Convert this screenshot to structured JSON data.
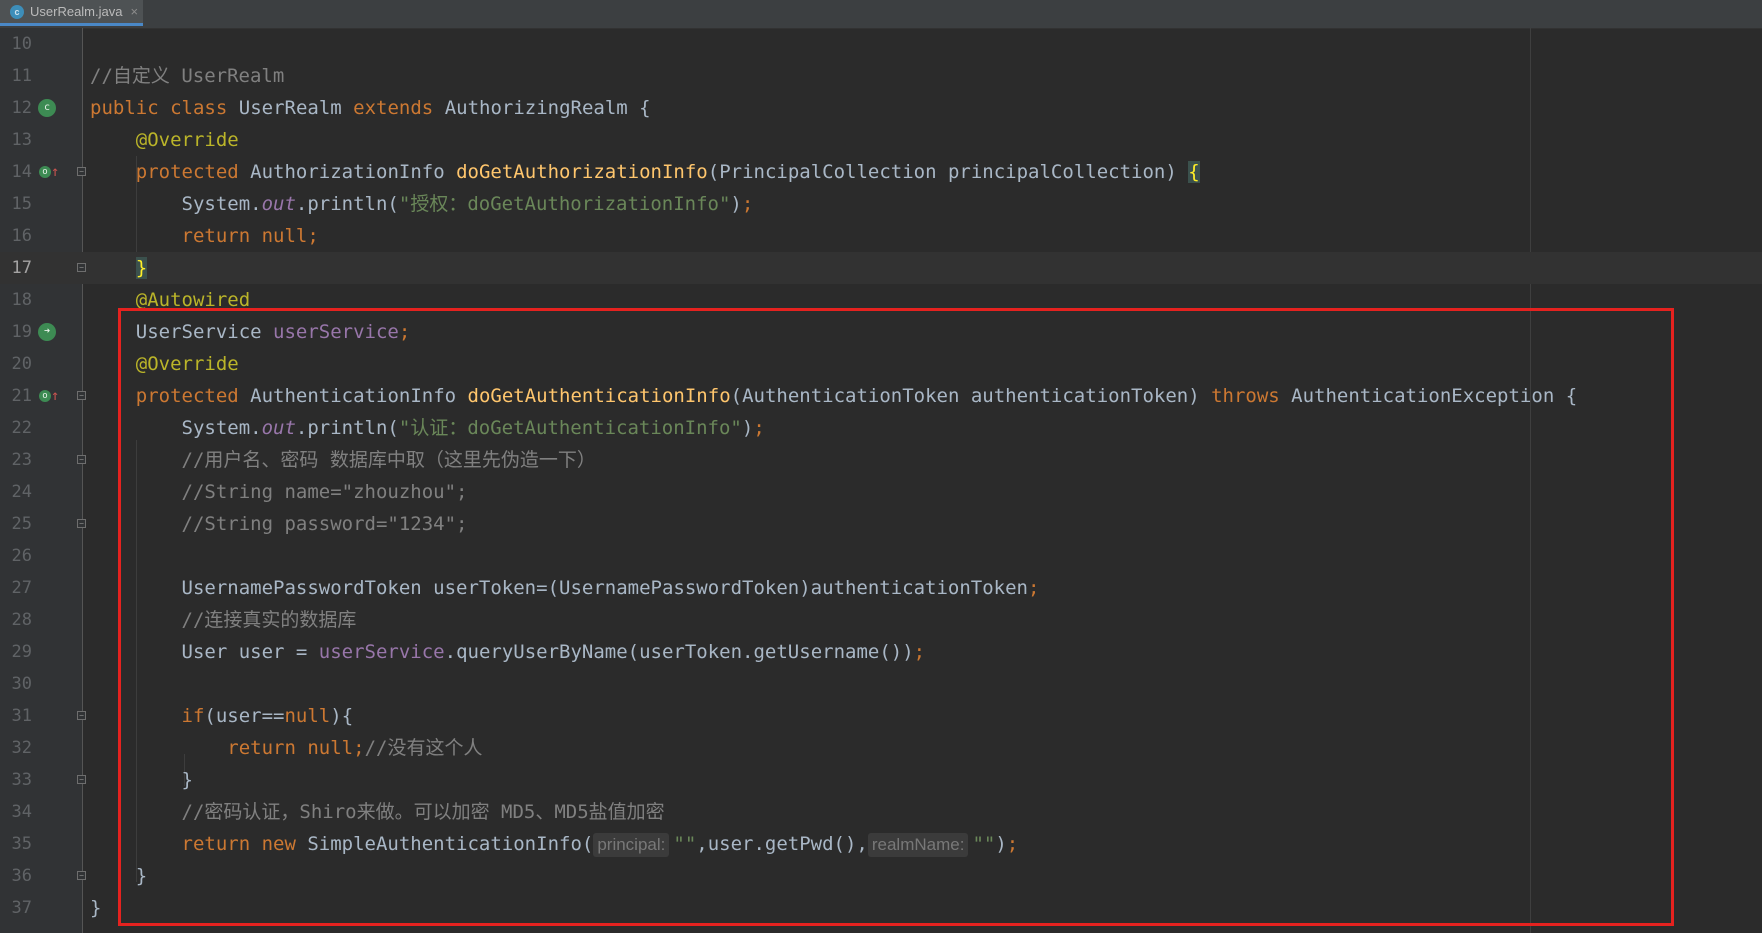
{
  "tab": {
    "label": "UserRealm.java",
    "file_icon": "java-class-icon",
    "close_glyph": "×"
  },
  "lines": {
    "l10": {
      "num": "10"
    },
    "l11": {
      "num": "11",
      "comment": "//自定义 UserRealm"
    },
    "l12": {
      "num": "12",
      "kw1": "public",
      "kw2": "class",
      "name": "UserRealm",
      "kw3": "extends",
      "parent": "AuthorizingRealm",
      "brace": "{"
    },
    "l13": {
      "num": "13",
      "ann": "@Override"
    },
    "l14": {
      "num": "14",
      "kw": "protected",
      "type": "AuthorizationInfo",
      "method": "doGetAuthorizationInfo",
      "params": "(PrincipalCollection principalCollection) ",
      "brace": "{"
    },
    "l15": {
      "num": "15",
      "pre": "System.",
      "out": "out",
      "call": ".println(",
      "str": "\"授权：doGetAuthorizationInfo\"",
      "end": ")",
      "semi": ";"
    },
    "l16": {
      "num": "16",
      "kw": "return null",
      "semi": ";"
    },
    "l17": {
      "num": "17",
      "brace": "}"
    },
    "l18": {
      "num": "18",
      "ann": "@Autowired"
    },
    "l19": {
      "num": "19",
      "type": "UserService ",
      "field": "userService",
      "semi": ";"
    },
    "l20": {
      "num": "20",
      "ann": "@Override"
    },
    "l21": {
      "num": "21",
      "kw": "protected",
      "type": "AuthenticationInfo",
      "method": "doGetAuthenticationInfo",
      "params": "(AuthenticationToken authenticationToken) ",
      "throws": "throws",
      "exc": " AuthenticationException {"
    },
    "l22": {
      "num": "22",
      "pre": "System.",
      "out": "out",
      "call": ".println(",
      "str": "\"认证：doGetAuthenticationInfo\"",
      "end": ")",
      "semi": ";"
    },
    "l23": {
      "num": "23",
      "comment": "//用户名、密码 数据库中取（这里先伪造一下）"
    },
    "l24": {
      "num": "24",
      "comment": "//String name=\"zhouzhou\";"
    },
    "l25": {
      "num": "25",
      "comment": "//String password=\"1234\";"
    },
    "l26": {
      "num": "26"
    },
    "l27": {
      "num": "27",
      "code": "UsernamePasswordToken userToken=(UsernamePasswordToken)authenticationToken",
      "semi": ";"
    },
    "l28": {
      "num": "28",
      "comment": "//连接真实的数据库"
    },
    "l29": {
      "num": "29",
      "pre": "User user = ",
      "field": "userService",
      "call": ".queryUserByName(userToken.getUsername())",
      "semi": ";"
    },
    "l30": {
      "num": "30"
    },
    "l31": {
      "num": "31",
      "kw": "if",
      "cond": "(user==",
      "null": "null",
      "end": "){"
    },
    "l32": {
      "num": "32",
      "kw": "return null",
      "semi": ";",
      "comment": "//没有这个人"
    },
    "l33": {
      "num": "33",
      "brace": "}"
    },
    "l34": {
      "num": "34",
      "comment": "//密码认证，Shiro来做。可以加密 MD5、MD5盐值加密"
    },
    "l35": {
      "num": "35",
      "kw": "return new",
      "call": " SimpleAuthenticationInfo(",
      "hint1": "principal:",
      "str1": "\"\"",
      "mid": ",user.getPwd(),",
      "hint2": "realmName:",
      "str2": "\"\"",
      "end": ")",
      "semi": ";"
    },
    "l36": {
      "num": "36",
      "brace": "}"
    },
    "l37": {
      "num": "37",
      "brace": "}"
    }
  },
  "gutter_icons": {
    "l12": "class-implements-icon",
    "l14": "override-method-icon",
    "l19": "autowired-bean-icon",
    "l21": "override-method-icon"
  },
  "colors": {
    "keyword": "#cc7832",
    "annotation": "#bbb529",
    "comment": "#808080",
    "string": "#6a8759",
    "field": "#9876aa",
    "method_decl": "#ffc66d",
    "highlight_box": "#e5221f"
  }
}
